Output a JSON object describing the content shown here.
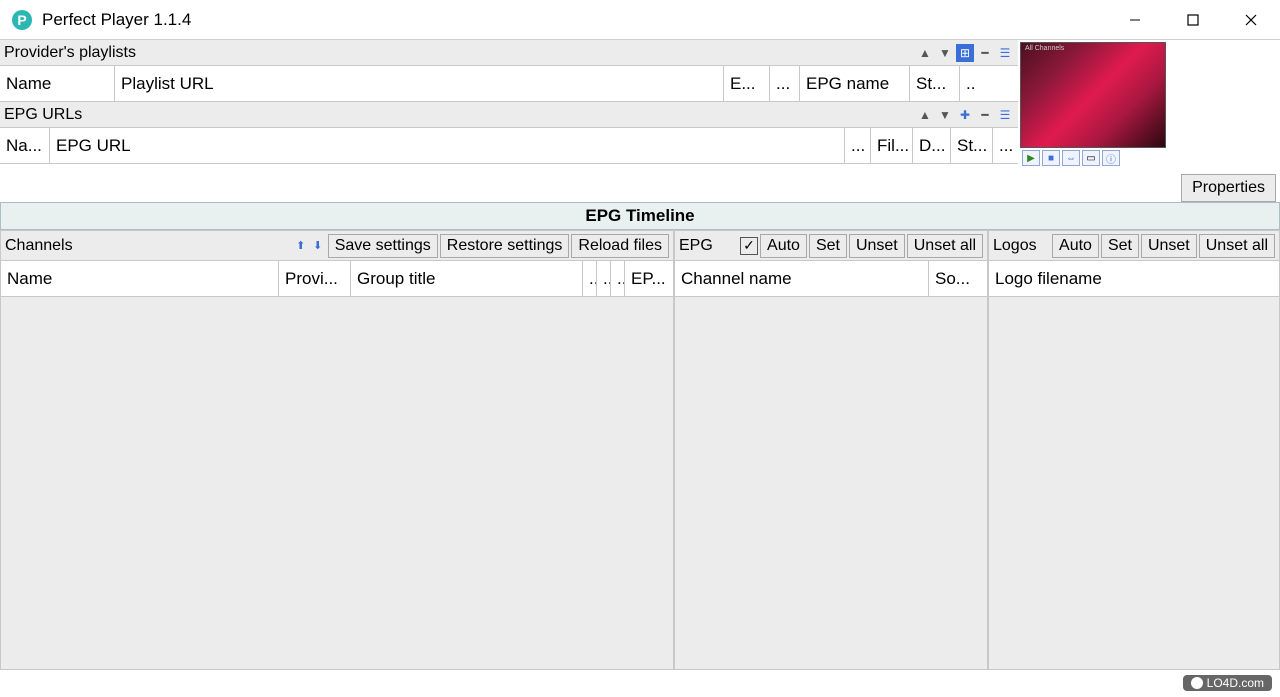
{
  "title": "Perfect Player 1.1.4",
  "playlists": {
    "label": "Provider's playlists",
    "cols": {
      "name": "Name",
      "url": "Playlist URL",
      "encoding": "E...",
      "more": "...",
      "epgname": "EPG name",
      "status": "St...",
      "ext": ".."
    }
  },
  "epgurls": {
    "label": "EPG URLs",
    "cols": {
      "name": "Na...",
      "url": "EPG URL",
      "more": "...",
      "file": "Fil...",
      "date": "D...",
      "status": "St...",
      "ext": "..."
    }
  },
  "preview": {
    "title": "All Channels"
  },
  "properties": "Properties",
  "timeline": "EPG Timeline",
  "channels": {
    "title": "Channels",
    "save": "Save settings",
    "restore": "Restore settings",
    "reload": "Reload files",
    "cols": {
      "name": "Name",
      "provider": "Provi...",
      "group": "Group title",
      "c1": "..",
      "c2": "..",
      "c3": "..",
      "epg": "EP..."
    }
  },
  "epg": {
    "title": "EPG",
    "auto": "Auto",
    "set": "Set",
    "unset": "Unset",
    "unsetall": "Unset all",
    "cols": {
      "channel": "Channel name",
      "source": "So..."
    }
  },
  "logos": {
    "title": "Logos",
    "auto": "Auto",
    "set": "Set",
    "unset": "Unset",
    "unsetall": "Unset all",
    "cols": {
      "filename": "Logo filename"
    }
  },
  "watermark": "LO4D.com"
}
